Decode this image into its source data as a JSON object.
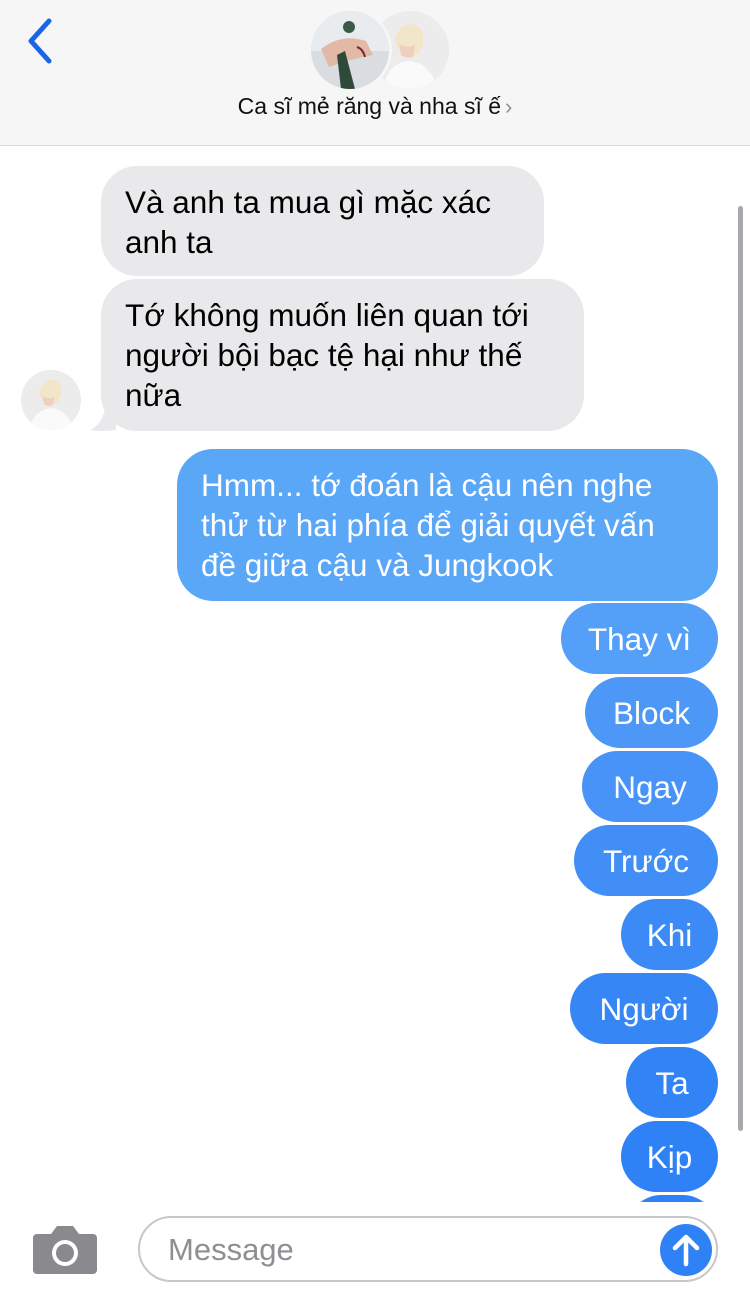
{
  "header": {
    "contact_name": "Ca sĩ mẻ răng và nha sĩ ế",
    "chevron": "›",
    "back_icon": "chevron-left-icon"
  },
  "messages": [
    {
      "sender": "them",
      "text": "Và anh ta mua gì mặc xác anh ta"
    },
    {
      "sender": "them",
      "text": "Tớ không muốn liên quan tới người bội bạc tệ hại như thế nữa"
    },
    {
      "sender": "me",
      "text": "Hmm... tớ đoán là cậu nên nghe thử từ hai phía để giải quyết vấn đề giữa cậu và Jungkook"
    },
    {
      "sender": "me",
      "text": "Thay vì"
    },
    {
      "sender": "me",
      "text": "Block"
    },
    {
      "sender": "me",
      "text": "Ngay"
    },
    {
      "sender": "me",
      "text": "Trước"
    },
    {
      "sender": "me",
      "text": "Khi"
    },
    {
      "sender": "me",
      "text": "Người"
    },
    {
      "sender": "me",
      "text": "Ta"
    },
    {
      "sender": "me",
      "text": "Kịp"
    }
  ],
  "input": {
    "placeholder": "Message",
    "value": ""
  },
  "colors": {
    "incoming_bubble": "#e9e9eb",
    "outgoing_top": "#5aa6f7",
    "outgoing_bottom": "#2f82f6",
    "header_bg": "#f6f6f6",
    "accent": "#1a64e6"
  },
  "icons": {
    "camera": "camera-icon",
    "send": "arrow-up-icon"
  }
}
